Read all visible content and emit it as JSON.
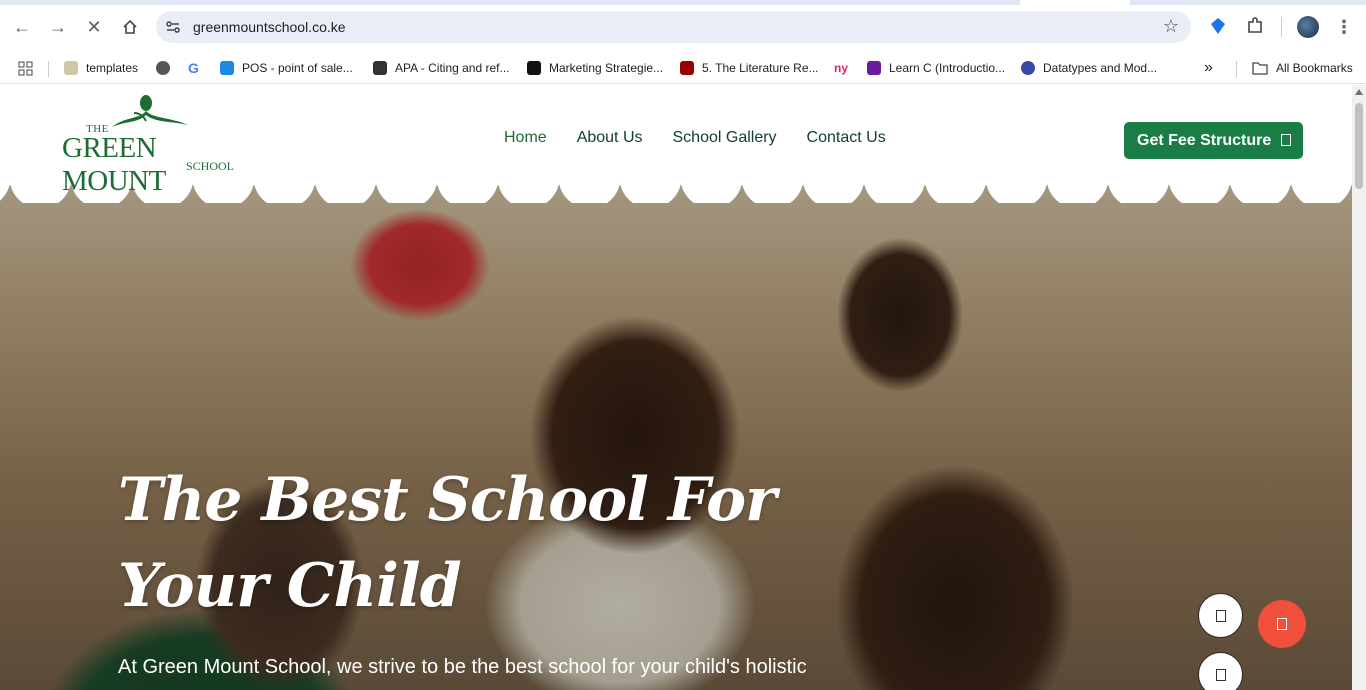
{
  "browser": {
    "url": "greenmountschool.co.ke",
    "bookmarks": [
      {
        "label": "templates",
        "icon": "folder-doc-icon",
        "color": "#b8b08a"
      },
      {
        "label": "",
        "icon": "globe-icon",
        "color": "#444444"
      },
      {
        "label": "",
        "icon": "google-icon",
        "color": "#4285f4"
      },
      {
        "label": "POS - point of sale...",
        "icon": "pos-icon",
        "color": "#1e88e5"
      },
      {
        "label": "APA - Citing and ref...",
        "icon": "apa-icon",
        "color": "#333333"
      },
      {
        "label": "Marketing Strategie...",
        "icon": "bulb-icon",
        "color": "#111111"
      },
      {
        "label": "5. The Literature Re...",
        "icon": "usc-icon",
        "color": "#990000"
      },
      {
        "label": "",
        "icon": "ny-icon",
        "color": "#e91e63"
      },
      {
        "label": "Learn C (Introductio...",
        "icon": "p-icon",
        "color": "#6a1b9a"
      },
      {
        "label": "Datatypes and Mod...",
        "icon": "st-icon",
        "color": "#3949ab"
      }
    ],
    "more_label": "»",
    "all_bookmarks": "All Bookmarks"
  },
  "site": {
    "logo": {
      "the": "THE",
      "name": "GREEN MOUNT",
      "school": "SCHOOL"
    },
    "nav": [
      "Home",
      "About Us",
      "School Gallery",
      "Contact Us"
    ],
    "cta": "Get Fee Structure",
    "hero": {
      "title": "The Best School For Your Child",
      "subtitle": "At Green Mount School, we strive to be the best school for your child's holistic"
    },
    "brand_color": "#1a7d45",
    "accent_color": "#f04f3b"
  }
}
